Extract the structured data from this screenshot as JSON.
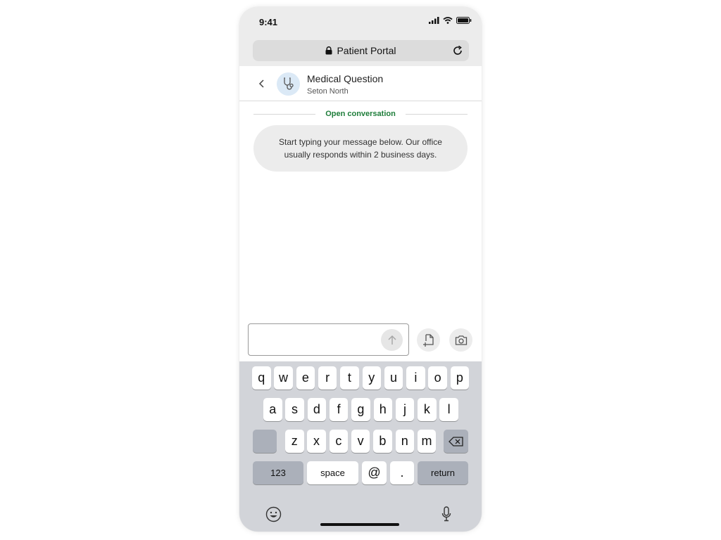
{
  "status_bar": {
    "time": "9:41"
  },
  "browser": {
    "title": "Patient Portal"
  },
  "conversation": {
    "title": "Medical Question",
    "subtitle": "Seton North",
    "status_label": "Open conversation",
    "info_message": "Start typing your message below. Our office usually responds within 2 business days."
  },
  "composer": {
    "value": "",
    "placeholder": ""
  },
  "keyboard": {
    "row1": [
      "q",
      "w",
      "e",
      "r",
      "t",
      "y",
      "u",
      "i",
      "o",
      "p"
    ],
    "row2": [
      "a",
      "s",
      "d",
      "f",
      "g",
      "h",
      "j",
      "k",
      "l"
    ],
    "row3": [
      "z",
      "x",
      "c",
      "v",
      "b",
      "n",
      "m"
    ],
    "numbers_label": "123",
    "space_label": "space",
    "at_label": "@",
    "period_label": ".",
    "return_label": "return"
  },
  "colors": {
    "accent_green": "#1e7d3a",
    "avatar_bg": "#dbe9f6",
    "keyboard_bg": "#d2d4d9"
  },
  "icons": [
    "lock-icon",
    "reload-icon",
    "back-chevron-icon",
    "stethoscope-icon",
    "send-arrow-icon",
    "attach-file-icon",
    "camera-icon",
    "shift-key",
    "backspace-icon",
    "emoji-icon",
    "microphone-icon"
  ]
}
